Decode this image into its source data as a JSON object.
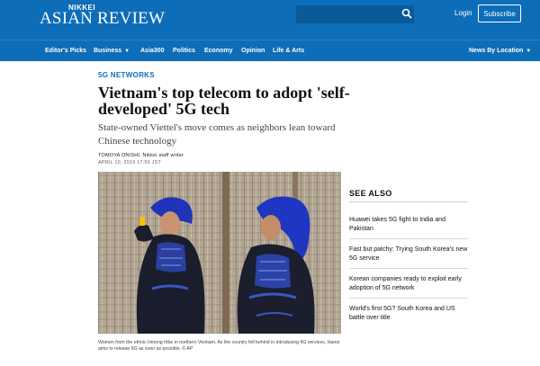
{
  "header": {
    "logo_top": "NIKKEI",
    "logo_main": "ASIAN REVIEW",
    "search_placeholder": "",
    "login_label": "Login",
    "subscribe_label": "Subscribe"
  },
  "nav": {
    "items": [
      {
        "label": "Editor's Picks"
      },
      {
        "label": "Business"
      },
      {
        "label": "Asia300"
      },
      {
        "label": "Politics"
      },
      {
        "label": "Economy"
      },
      {
        "label": "Opinion"
      },
      {
        "label": "Life & Arts"
      }
    ],
    "right_label": "News By Location"
  },
  "article": {
    "kicker": "5G NETWORKS",
    "headline": "Vietnam's top telecom to adopt 'self-developed' 5G tech",
    "subheadline": "State-owned Viettel's move comes as neighbors lean toward Chinese technology",
    "byline": "TOMOYA ONISHI, Nikkei staff writer",
    "date": "APRIL 10, 2019 17:59 JST",
    "caption": "Women from the ethnic Hmong tribe in northern Vietnam. As the country fell behind in introducing 4G services, Hanoi aims to release 5G as soon as possible.  © AP"
  },
  "sidebar": {
    "title": "SEE ALSO",
    "items": [
      {
        "text": "Huawei takes 5G fight to India and Pakistan"
      },
      {
        "text": "Fast but patchy: Trying South Korea's new 5G service"
      },
      {
        "text": "Korean companies ready to exploit early adoption of 5G network"
      },
      {
        "text": "World's first 5G? South Korea and US battle over title"
      }
    ]
  },
  "colors": {
    "brand_blue": "#0d6db8",
    "kicker_blue": "#0d6db8"
  }
}
